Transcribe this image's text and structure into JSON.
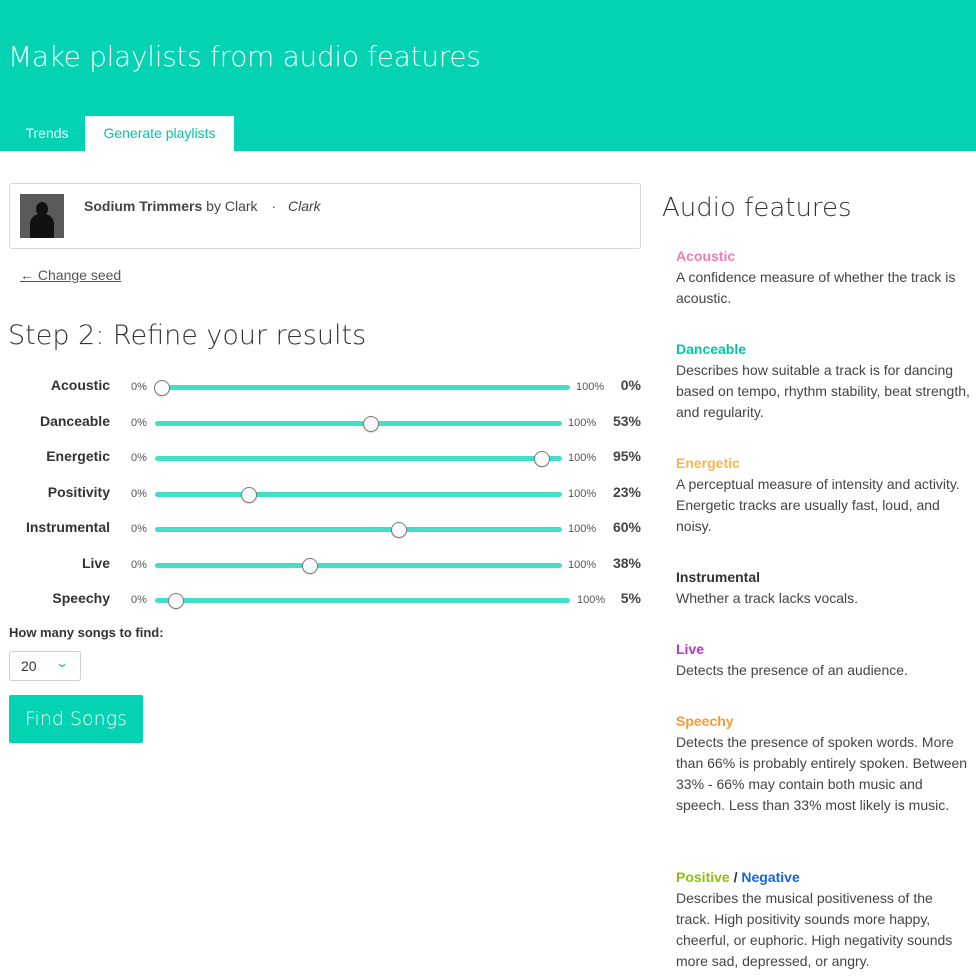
{
  "header": {
    "title": "Make playlists from audio features",
    "tabs": [
      {
        "label": "Trends"
      },
      {
        "label": "Generate playlists",
        "active": true
      }
    ],
    "accent_color": "#03d3b3"
  },
  "seed": {
    "track": "Sodium Trimmers",
    "by": "by",
    "artist": "Clark",
    "separator": "·",
    "album": "Clark",
    "change_label": "← Change seed"
  },
  "refine": {
    "title": "Step 2: Refine your results",
    "sliders": [
      {
        "label": "Acoustic",
        "min_label": "0%",
        "max_label": "100%",
        "value": 0,
        "value_label": "0%"
      },
      {
        "label": "Danceable",
        "min_label": "0%",
        "max_label": "100%",
        "value": 53,
        "value_label": "53%"
      },
      {
        "label": "Energetic",
        "min_label": "0%",
        "max_label": "100%",
        "value": 95,
        "value_label": "95%"
      },
      {
        "label": "Positivity",
        "min_label": "0%",
        "max_label": "100%",
        "value": 23,
        "value_label": "23%"
      },
      {
        "label": "Instrumental",
        "min_label": "0%",
        "max_label": "100%",
        "value": 60,
        "value_label": "60%"
      },
      {
        "label": "Live",
        "min_label": "0%",
        "max_label": "100%",
        "value": 38,
        "value_label": "38%"
      },
      {
        "label": "Speechy",
        "min_label": "0%",
        "max_label": "100%",
        "value": 5,
        "value_label": "5%"
      }
    ],
    "count_label": "How many songs to find:",
    "count_value": "20",
    "find_button": "Find Songs"
  },
  "audio_features": {
    "title": "Audio features",
    "items": [
      {
        "name": "Acoustic",
        "color": "#f07cb5",
        "desc": "A confidence measure of whether the track is acoustic."
      },
      {
        "name": "Danceable",
        "color": "#03c4a7",
        "desc": "Describes how suitable a track is for dancing based on tempo, rhythm stability, beat strength, and regularity."
      },
      {
        "name": "Energetic",
        "color": "#f2b94a",
        "desc": "A perceptual measure of intensity and activity. Energetic tracks are usually fast, loud, and noisy."
      },
      {
        "name": "Instrumental",
        "color": "#333333",
        "desc": "Whether a track lacks vocals."
      },
      {
        "name": "Live",
        "color": "#c02fd0",
        "desc": "Detects the presence of an audience."
      },
      {
        "name": "Speechy",
        "color": "#f39b3a",
        "desc": "Detects the presence of spoken words. More than 66% is probably entirely spoken. Between 33% - 66% may contain both music and speech. Less than 33% most likely is music."
      }
    ],
    "positive_negative": {
      "positive": "Positive",
      "positive_color": "#8fbf0e",
      "slash": "/",
      "negative": "Negative",
      "negative_color": "#1466d6",
      "desc": "Describes the musical positiveness of the track. High positivity sounds more happy, cheerful, or euphoric. High negativity sounds more sad, depressed, or angry."
    }
  }
}
